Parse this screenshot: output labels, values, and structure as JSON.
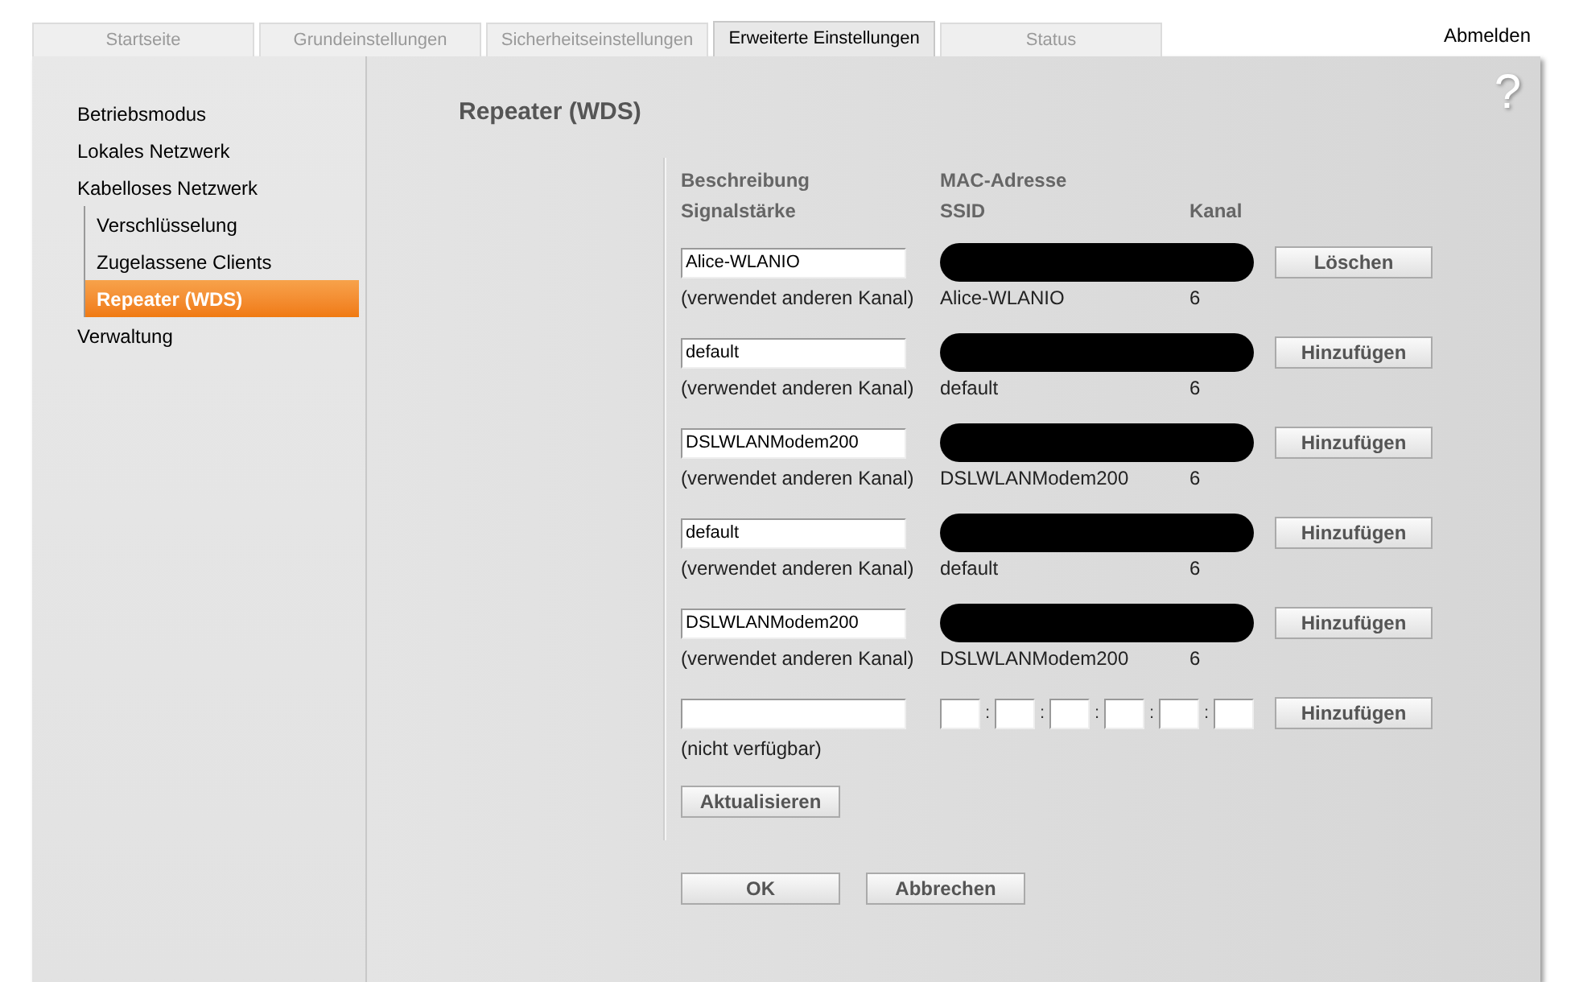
{
  "tabs": [
    {
      "label": "Startseite",
      "selected": false
    },
    {
      "label": "Grundeinstellungen",
      "selected": false
    },
    {
      "label": "Sicherheitseinstellungen",
      "selected": false
    },
    {
      "label": "Erweiterte Einstellungen",
      "selected": true
    },
    {
      "label": "Status",
      "selected": false
    }
  ],
  "logout": "Abmelden",
  "help": "?",
  "sidebar": {
    "items": [
      {
        "label": "Betriebsmodus",
        "selected": false
      },
      {
        "label": "Lokales Netzwerk",
        "selected": false
      },
      {
        "label": "Kabelloses Netzwerk",
        "selected": false,
        "children": [
          {
            "label": "Verschlüsselung",
            "selected": false
          },
          {
            "label": "Zugelassene Clients",
            "selected": false
          },
          {
            "label": "Repeater (WDS)",
            "selected": true
          }
        ]
      },
      {
        "label": "Verwaltung",
        "selected": false
      }
    ]
  },
  "title": "Repeater (WDS)",
  "headers": {
    "row_1": [
      "Beschreibung",
      "MAC-Adresse"
    ],
    "row_2": [
      "Signalstärke",
      "SSID",
      "Kanal"
    ]
  },
  "entries": [
    {
      "description": "Alice-WLANIO",
      "mac_redacted": true,
      "button": "Löschen",
      "signal": "(verwendet anderen Kanal)",
      "ssid": "Alice-WLANIO",
      "channel": "6"
    },
    {
      "description": "default",
      "mac_redacted": true,
      "button": "Hinzufügen",
      "signal": "(verwendet anderen Kanal)",
      "ssid": "default",
      "channel": "6"
    },
    {
      "description": "DSLWLANModem200",
      "mac_redacted": true,
      "button": "Hinzufügen",
      "signal": "(verwendet anderen Kanal)",
      "ssid": "DSLWLANModem200",
      "channel": "6"
    },
    {
      "description": "default",
      "mac_redacted": true,
      "button": "Hinzufügen",
      "signal": "(verwendet anderen Kanal)",
      "ssid": "default",
      "channel": "6"
    },
    {
      "description": "DSLWLANModem200",
      "mac_redacted": true,
      "button": "Hinzufügen",
      "signal": "(verwendet anderen Kanal)",
      "ssid": "DSLWLANModem200",
      "channel": "6"
    },
    {
      "mac_redacted": false,
      "mac_separators": [
        ":",
        ":",
        ":",
        ":",
        ":"
      ],
      "button": "Hinzufügen",
      "signal": "(nicht verfügbar)"
    }
  ],
  "refresh_button": "Aktualisieren",
  "footer_buttons": [
    "OK",
    "Abbrechen"
  ]
}
